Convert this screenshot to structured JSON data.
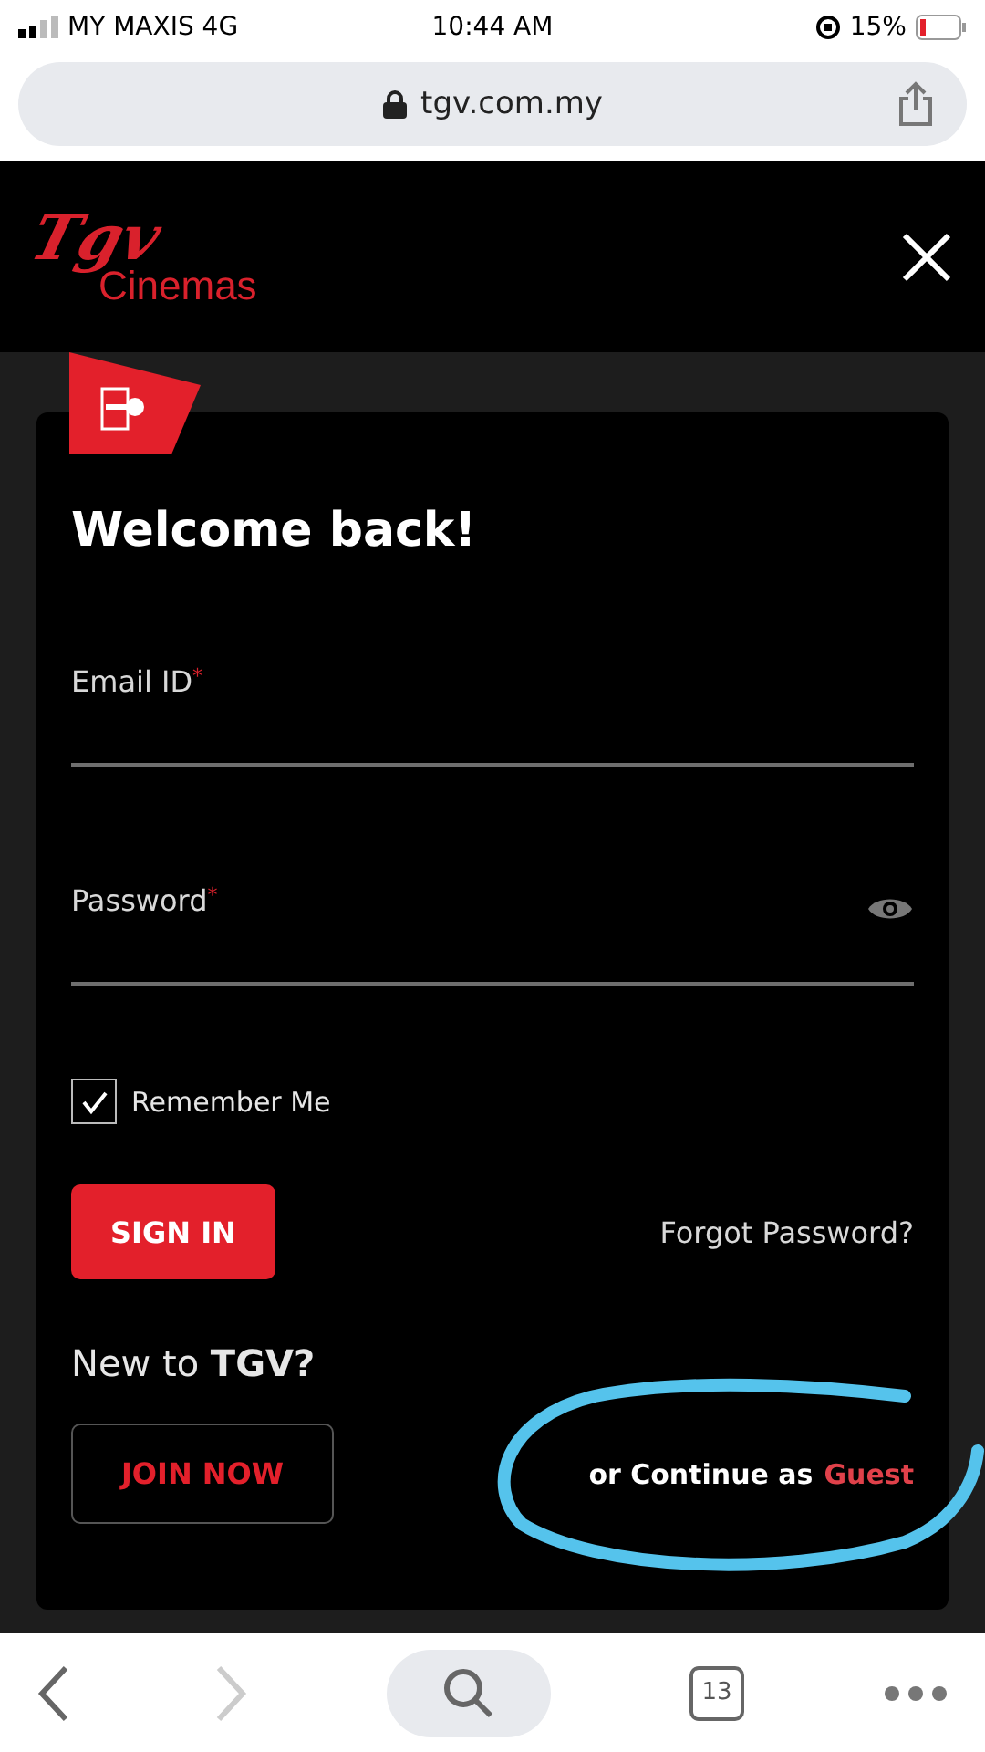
{
  "status_bar": {
    "carrier": "MY MAXIS 4G",
    "time": "10:44 AM",
    "battery": "15%"
  },
  "address_bar": {
    "url": "tgv.com.my"
  },
  "header": {
    "logo_script": "Tgv",
    "logo_word": "Cinemas"
  },
  "login": {
    "title": "Welcome back!",
    "fields": [
      {
        "label": "Email ID",
        "mark": "*",
        "kind": "text"
      },
      {
        "label": "Password",
        "mark": "*",
        "kind": "password"
      }
    ],
    "remember": {
      "label": "Remember Me",
      "checked": true
    },
    "sign_in": "SIGN IN",
    "forgot": "Forgot Password?",
    "new_to": "New to **TGV?**",
    "join": "JOIN NOW",
    "guest": {
      "prefix": "or Continue as",
      "link": "Guest"
    }
  },
  "toolbar": {
    "tabs_count": "13"
  }
}
